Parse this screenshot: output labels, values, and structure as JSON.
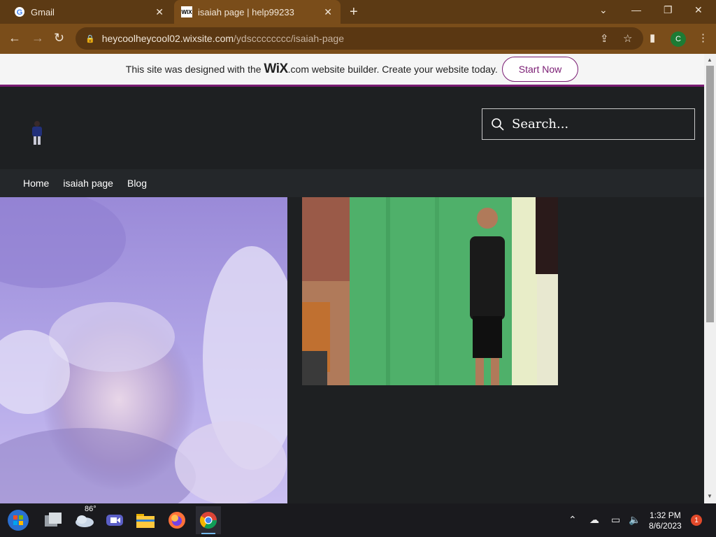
{
  "browser": {
    "tabs": [
      {
        "title": "Gmail",
        "favicon": "google-g-icon",
        "active": false
      },
      {
        "title": "isaiah page | help99233",
        "favicon": "wix-icon",
        "active": true
      }
    ],
    "url_host": "heycoolheycool02.wixsite.com",
    "url_path": "/ydscccccccc/isaiah-page",
    "profile_initial": "C",
    "colors": {
      "frame": "#5c3a14",
      "toolbar": "#7a4d1a"
    }
  },
  "wix_banner": {
    "text_before": "This site was designed with the ",
    "logo": "WiX",
    "text_after": ".com website builder. Create your website today.",
    "button": "Start Now",
    "accent": "#7a1c73"
  },
  "site": {
    "search_placeholder": "Search...",
    "menu": [
      "Home",
      "isaiah page",
      "Blog"
    ]
  },
  "taskbar": {
    "weather_temp": "86°",
    "time": "1:32 PM",
    "date": "8/6/2023",
    "notification_count": "1"
  }
}
